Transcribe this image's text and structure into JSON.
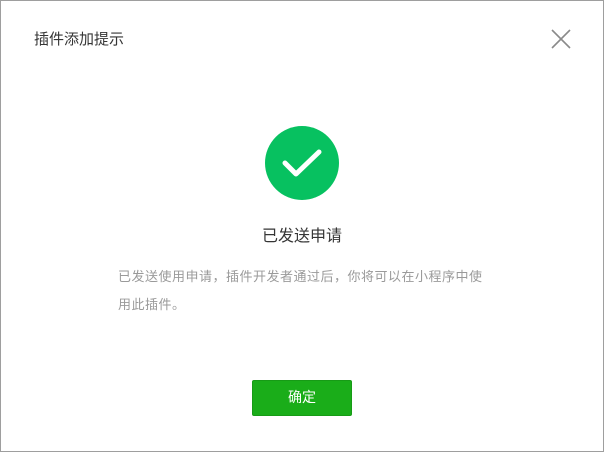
{
  "dialog": {
    "title": "插件添加提示",
    "close_icon": "close-icon",
    "success_icon": "checkmark-circle-icon",
    "message_title": "已发送申请",
    "message_description": "已发送使用申请，插件开发者通过后，你将可以在小程序中使用此插件。",
    "confirm_label": "确定"
  },
  "colors": {
    "success_green": "#07c160",
    "button_green": "#1aad19",
    "title_text": "#353535",
    "desc_text": "#9a9a9a"
  }
}
